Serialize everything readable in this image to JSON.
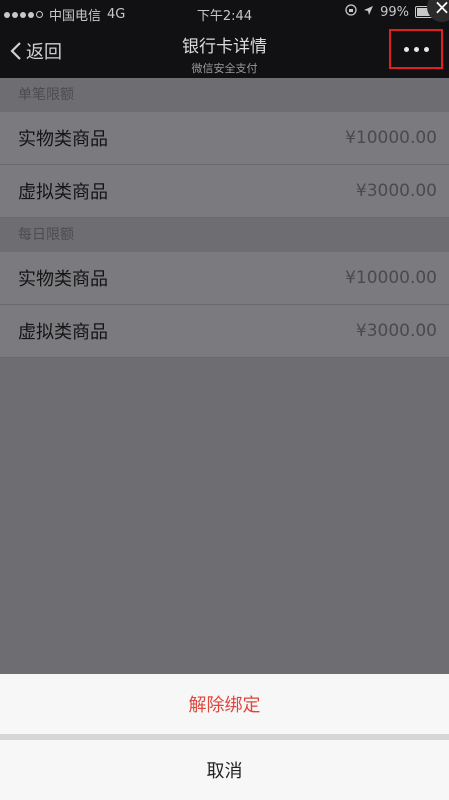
{
  "status_bar": {
    "carrier": "中国电信",
    "network": "4G",
    "time": "下午2:44",
    "battery": "99%",
    "battery_level": 0.99
  },
  "nav": {
    "back_label": "返回",
    "title": "银行卡详情",
    "subtitle": "微信安全支付"
  },
  "sections": [
    {
      "header": "单笔限额",
      "rows": [
        {
          "label": "实物类商品",
          "amount": "¥10000.00"
        },
        {
          "label": "虚拟类商品",
          "amount": "¥3000.00"
        }
      ]
    },
    {
      "header": "每日限额",
      "rows": [
        {
          "label": "实物类商品",
          "amount": "¥10000.00"
        },
        {
          "label": "虚拟类商品",
          "amount": "¥3000.00"
        }
      ]
    }
  ],
  "action_sheet": {
    "unbind_label": "解除绑定",
    "cancel_label": "取消"
  },
  "colors": {
    "danger": "#e0463c",
    "highlight_box": "#e02020"
  }
}
